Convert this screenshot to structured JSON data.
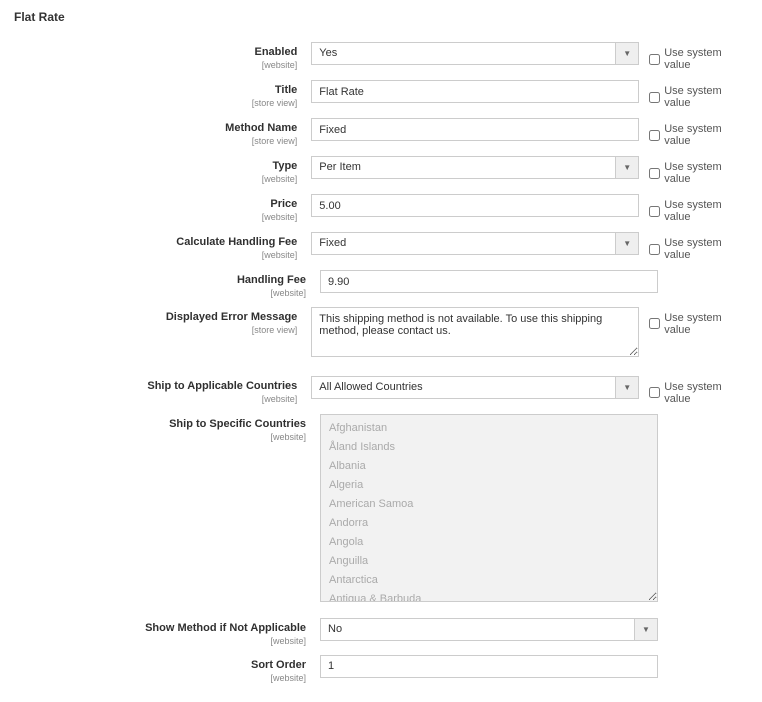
{
  "section_title": "Flat Rate",
  "use_system_value_label": "Use system value",
  "fields": {
    "enabled": {
      "label": "Enabled",
      "scope": "[website]",
      "value": "Yes",
      "type": "select",
      "sys": true
    },
    "title": {
      "label": "Title",
      "scope": "[store view]",
      "value": "Flat Rate",
      "type": "text",
      "sys": true
    },
    "method_name": {
      "label": "Method Name",
      "scope": "[store view]",
      "value": "Fixed",
      "type": "text",
      "sys": true
    },
    "type": {
      "label": "Type",
      "scope": "[website]",
      "value": "Per Item",
      "type": "select",
      "sys": true
    },
    "price": {
      "label": "Price",
      "scope": "[website]",
      "value": "5.00",
      "type": "text",
      "sys": true
    },
    "calc_handling": {
      "label": "Calculate Handling Fee",
      "scope": "[website]",
      "value": "Fixed",
      "type": "select",
      "sys": true
    },
    "handling_fee": {
      "label": "Handling Fee",
      "scope": "[website]",
      "value": "9.90",
      "type": "text",
      "sys": false
    },
    "error_msg": {
      "label": "Displayed Error Message",
      "scope": "[store view]",
      "value": "This shipping method is not available. To use this shipping method, please contact us.",
      "type": "textarea",
      "sys": true
    },
    "ship_applicable": {
      "label": "Ship to Applicable Countries",
      "scope": "[website]",
      "value": "All Allowed Countries",
      "type": "select",
      "sys": true
    },
    "ship_specific": {
      "label": "Ship to Specific Countries",
      "scope": "[website]",
      "type": "multiselect",
      "options": [
        "Afghanistan",
        "Åland Islands",
        "Albania",
        "Algeria",
        "American Samoa",
        "Andorra",
        "Angola",
        "Anguilla",
        "Antarctica",
        "Antigua & Barbuda"
      ]
    },
    "show_method": {
      "label": "Show Method if Not Applicable",
      "scope": "[website]",
      "value": "No",
      "type": "select",
      "sys": false
    },
    "sort_order": {
      "label": "Sort Order",
      "scope": "[website]",
      "value": "1",
      "type": "text",
      "sys": false
    }
  }
}
